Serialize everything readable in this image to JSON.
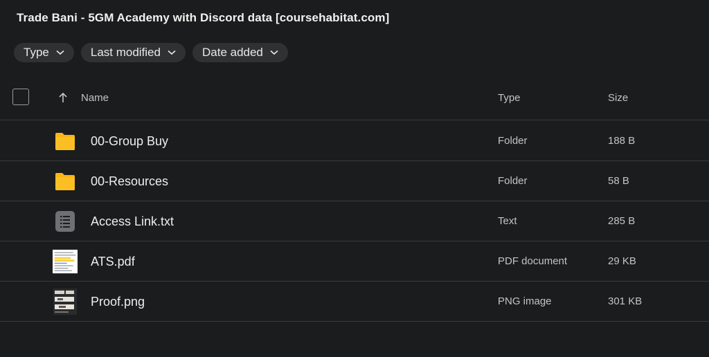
{
  "page": {
    "title": "Trade Bani - 5GM Academy with Discord data [coursehabitat.com]"
  },
  "filters": [
    {
      "label": "Type",
      "icon": "chevron-down-icon"
    },
    {
      "label": "Last modified",
      "icon": "chevron-down-icon"
    },
    {
      "label": "Date added",
      "icon": "chevron-down-icon"
    }
  ],
  "table": {
    "headers": {
      "name": "Name",
      "type": "Type",
      "size": "Size"
    },
    "sort_icon": "arrow-up-icon",
    "rows": [
      {
        "name": "00-Group Buy",
        "type": "Folder",
        "size": "188 B",
        "icon": "folder-icon"
      },
      {
        "name": "00-Resources",
        "type": "Folder",
        "size": "58 B",
        "icon": "folder-icon"
      },
      {
        "name": "Access Link.txt",
        "type": "Text",
        "size": "285 B",
        "icon": "text-file-icon"
      },
      {
        "name": "ATS.pdf",
        "type": "PDF document",
        "size": "29 KB",
        "icon": "pdf-thumbnail-icon"
      },
      {
        "name": "Proof.png",
        "type": "PNG image",
        "size": "301 KB",
        "icon": "image-thumbnail-icon"
      }
    ]
  },
  "colors": {
    "background": "#1b1c1d",
    "chip": "#2f3133",
    "folder": "#f9b614",
    "divider": "#3a3b3d"
  }
}
